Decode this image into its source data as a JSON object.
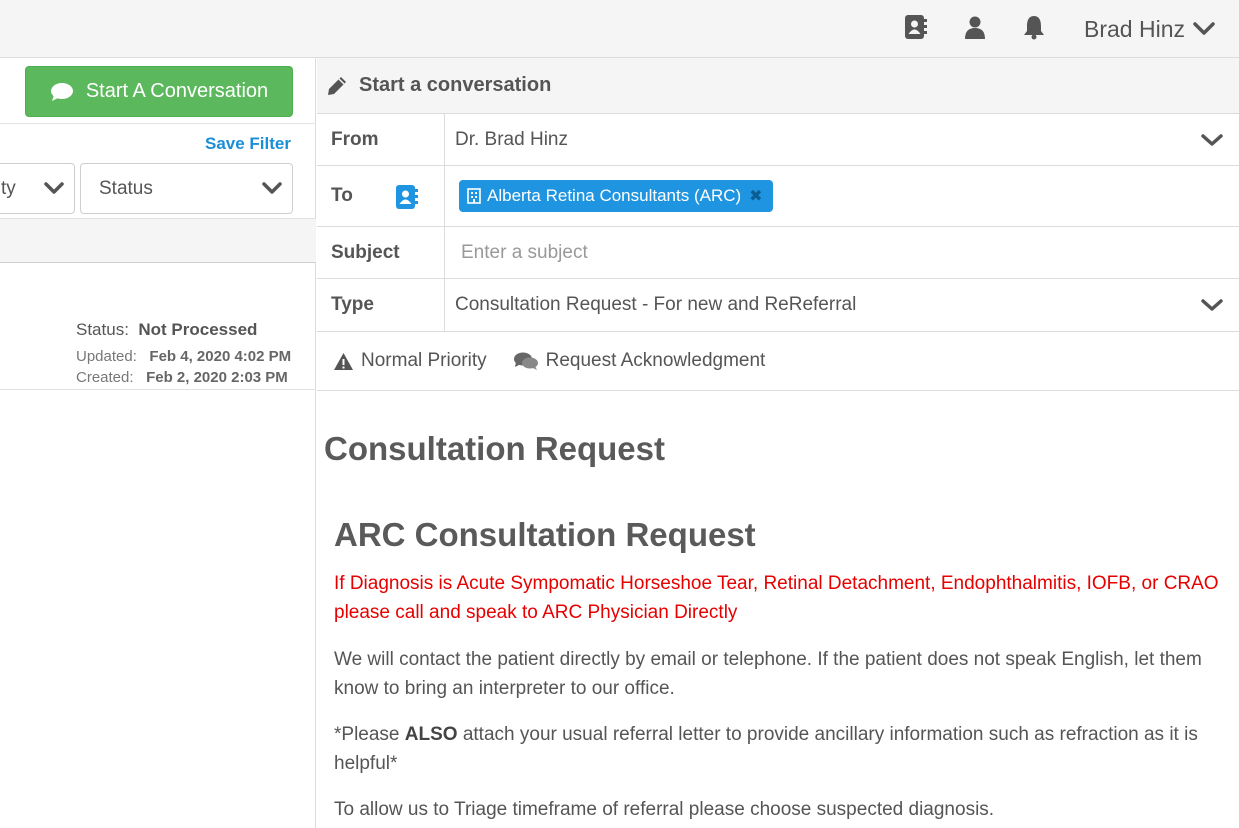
{
  "topbar": {
    "icons": [
      "address-book-icon",
      "user-icon",
      "bell-icon"
    ],
    "user_name": "Brad Hinz"
  },
  "left_panel": {
    "start_button_label": "Start A Conversation",
    "save_filter_label": "Save Filter",
    "filter_priority_label": "ty",
    "filter_status_label": "Status",
    "item": {
      "status_label": "Status:",
      "status_value": "Not Processed",
      "updated_label": "Updated:",
      "updated_value": "Feb 4, 2020 4:02 PM",
      "created_label": "Created:",
      "created_value": "Feb 2, 2020 2:03 PM"
    }
  },
  "compose": {
    "header_title": "Start a conversation",
    "from_label": "From",
    "from_value": "Dr. Brad Hinz",
    "to_label": "To",
    "to_recipient": "Alberta Retina Consultants (ARC)",
    "subject_label": "Subject",
    "subject_placeholder": "Enter a subject",
    "type_label": "Type",
    "type_value": "Consultation Request - For new and ReReferral",
    "priority_label": "Normal Priority",
    "ack_label": "Request Acknowledgment"
  },
  "form": {
    "title": "Consultation Request",
    "subtitle": "ARC Consultation Request",
    "warning": "If Diagnosis is Acute Sympomatic Horseshoe Tear, Retinal Detachment, Endophthalmitis, IOFB, or CRAO please call and speak to ARC Physician Directly",
    "contact_note": "We will contact the patient directly by email or telephone. If the patient does not speak English, let them know to bring an interpreter to our office.",
    "attach_prefix": "*Please ",
    "attach_bold": "ALSO",
    "attach_suffix": " attach your usual referral letter to provide ancillary information such as refraction as it is helpful*",
    "triage_note": "To allow us to Triage timeframe of referral please choose suspected diagnosis."
  },
  "colors": {
    "accent_green": "#5cb85c",
    "link_blue": "#1a8fd8",
    "tag_blue": "#1f94e0",
    "warning_red": "#e60000"
  }
}
